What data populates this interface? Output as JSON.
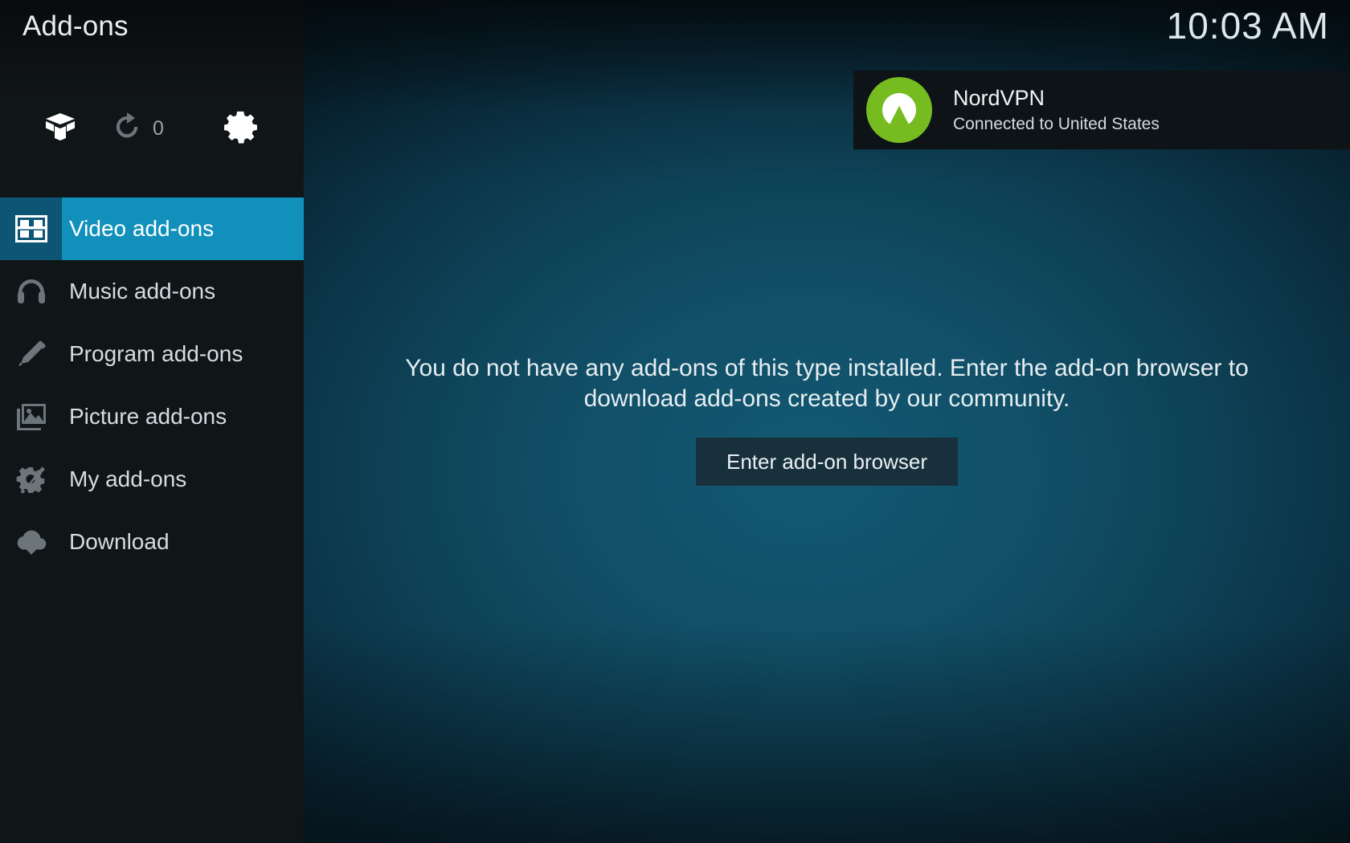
{
  "window": {
    "title": "Add-ons",
    "clock": "10:03 AM"
  },
  "colors": {
    "selection_label_bg": "#1190bc",
    "selection_icon_bg": "#0d5574",
    "sidebar_bg": "#101518",
    "nordvpn_green": "#76bc21",
    "button_bg": "#18303c",
    "content_gradient_center": "#125872"
  },
  "toolbar": {
    "install_from_zip_icon": "open-box-icon",
    "check_updates_icon": "refresh-icon",
    "update_count": "0",
    "settings_icon": "gear-icon"
  },
  "sidebar": {
    "items": [
      {
        "label": "Video add-ons",
        "icon": "film-strip-icon",
        "selected": true
      },
      {
        "label": "Music add-ons",
        "icon": "headphones-icon",
        "selected": false
      },
      {
        "label": "Program add-ons",
        "icon": "pencil-ruler-icon",
        "selected": false
      },
      {
        "label": "Picture add-ons",
        "icon": "photo-icon",
        "selected": false
      },
      {
        "label": "My add-ons",
        "icon": "gear-wrench-icon",
        "selected": false
      },
      {
        "label": "Download",
        "icon": "cloud-download-icon",
        "selected": false
      }
    ]
  },
  "notification": {
    "title": "NordVPN",
    "subtitle": "Connected to United States",
    "logo_icon": "nordvpn-mountain-icon"
  },
  "main": {
    "empty_message": "You do not have any add-ons of this type installed. Enter the add-on browser to download add-ons created by our community.",
    "button_label": "Enter add-on browser"
  }
}
